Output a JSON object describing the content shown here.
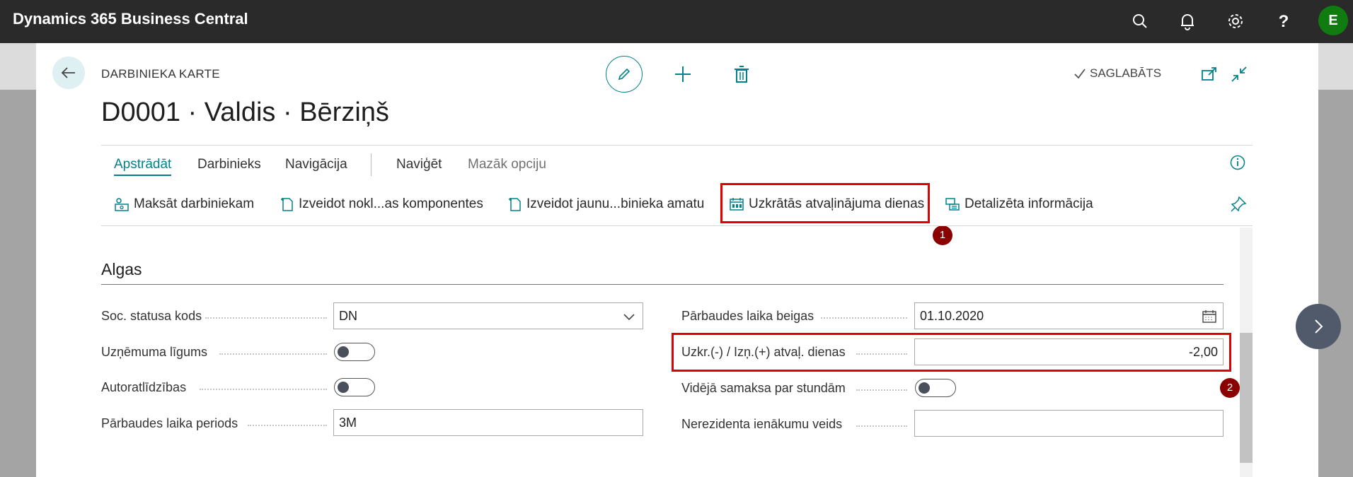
{
  "app": {
    "title": "Dynamics 365 Business Central",
    "user_initial": "E"
  },
  "topbar_icons": [
    "search-icon",
    "bell-icon",
    "gear-icon",
    "help-icon"
  ],
  "page": {
    "caption": "DARBINIEKA KARTE",
    "title": "D0001 · Valdis · Bērziņš",
    "saved_status": "SAGLABĀTS"
  },
  "tabs": [
    {
      "label": "Apstrādāt",
      "active": true
    },
    {
      "label": "Darbinieks"
    },
    {
      "label": "Navigācija"
    },
    {
      "label": "Naviģēt"
    },
    {
      "label": "Mazāk opciju"
    }
  ],
  "commands": [
    {
      "label": "Maksāt darbiniekam",
      "icon": "pay-icon"
    },
    {
      "label": "Izveidot nokl...as komponentes",
      "icon": "new-document-icon"
    },
    {
      "label": "Izveidot jaunu...binieka amatu",
      "icon": "new-document-icon"
    },
    {
      "label": "Uzkrātās atvaļinājuma dienas",
      "icon": "calendar-report-icon"
    },
    {
      "label": "Detalizēta informācija",
      "icon": "details-icon"
    }
  ],
  "annotations": {
    "badge1": "1",
    "badge2": "2"
  },
  "section": {
    "title": "Algas",
    "left_fields": [
      {
        "label": "Soc. statusa kods",
        "type": "select",
        "value": "DN"
      },
      {
        "label": "Uzņēmuma līgums",
        "type": "toggle",
        "on": false
      },
      {
        "label": "Autoratlīdzības",
        "type": "toggle",
        "on": false
      },
      {
        "label": "Pārbaudes laika periods",
        "type": "text",
        "value": "3M"
      }
    ],
    "right_fields": [
      {
        "label": "Pārbaudes laika beigas",
        "type": "date",
        "value": "01.10.2020"
      },
      {
        "label": "Uzkr.(-) / Izņ.(+) atvaļ. dienas",
        "type": "number",
        "value": "-2,00"
      },
      {
        "label": "Vidējā samaksa par stundām",
        "type": "toggle",
        "on": false
      },
      {
        "label": "Nerezidenta ienākumu veids",
        "type": "text",
        "value": ""
      }
    ]
  },
  "colors": {
    "accent": "#00828a",
    "topbar": "#2a2a2a",
    "highlight": "#e00000",
    "badge": "#8b0000"
  }
}
